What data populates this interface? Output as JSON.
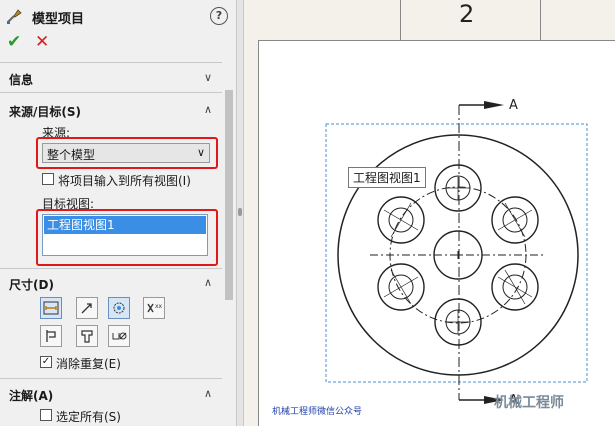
{
  "property_manager": {
    "title": "模型项目",
    "icons": {
      "title_icon": "model-items-icon",
      "help": "help-icon",
      "ok": "checkmark-icon",
      "cancel": "close-icon"
    },
    "help_label": "?",
    "ok_glyph": "✔",
    "cancel_glyph": "✕",
    "groups": {
      "info": {
        "label": "信息",
        "state": "collapsed"
      },
      "source": {
        "label": "来源/目标(S)",
        "state": "expanded"
      },
      "dimensions": {
        "label": "尺寸(D)",
        "state": "expanded"
      },
      "annotations": {
        "label": "注解(A)",
        "state": "expanded"
      }
    },
    "source": {
      "source_label": "来源:",
      "source_value": "整个模型",
      "import_all_views": {
        "label": "将项目输入到所有视图(I)",
        "checked": false
      },
      "target_label": "目标视图:",
      "target_items": [
        "工程图视图1"
      ]
    },
    "dimensions": {
      "remove_duplicates": {
        "label": "消除重复(E)",
        "checked": true
      }
    },
    "annotations": {
      "select_all": {
        "label": "选定所有(S)",
        "checked": false
      }
    }
  },
  "drawing": {
    "sheet_zone": "2",
    "tooltip": "工程图视图1",
    "section_label_top": "A",
    "section_label_bottom": "A",
    "watermark_left": "机械工程师微信公众号",
    "watermark_right": "机械工程师"
  },
  "colors": {
    "ok": "#2b9a2b",
    "cancel": "#d61f1f",
    "highlight": "#e01818",
    "selection": "#3b8ee5",
    "view_border": "#4a90d9"
  }
}
